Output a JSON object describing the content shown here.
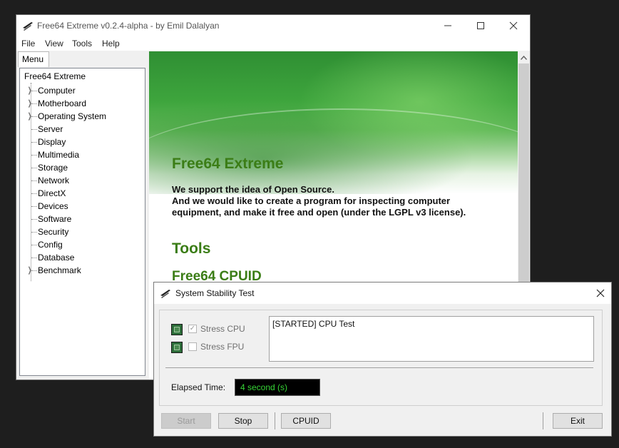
{
  "main_window": {
    "title": "Free64 Extreme v0.2.4-alpha - by Emil Dalalyan",
    "menu": [
      "File",
      "View",
      "Tools",
      "Help"
    ],
    "tab_label": "Menu",
    "tree": {
      "root": "Free64 Extreme",
      "items": [
        {
          "label": "Computer",
          "expandable": true
        },
        {
          "label": "Motherboard",
          "expandable": true
        },
        {
          "label": "Operating System",
          "expandable": true
        },
        {
          "label": "Server",
          "expandable": false
        },
        {
          "label": "Display",
          "expandable": false
        },
        {
          "label": "Multimedia",
          "expandable": false
        },
        {
          "label": "Storage",
          "expandable": false
        },
        {
          "label": "Network",
          "expandable": false
        },
        {
          "label": "DirectX",
          "expandable": false
        },
        {
          "label": "Devices",
          "expandable": false
        },
        {
          "label": "Software",
          "expandable": false
        },
        {
          "label": "Security",
          "expandable": false
        },
        {
          "label": "Config",
          "expandable": false
        },
        {
          "label": "Database",
          "expandable": false
        },
        {
          "label": "Benchmark",
          "expandable": true
        }
      ]
    },
    "content": {
      "heading": "Free64 Extreme",
      "paragraph_lines": [
        "We support the idea of Open Source.",
        "And we would like to create a program for inspecting computer",
        "equipment, and make it free and open (under the LGPL v3 license)."
      ],
      "section_heading": "Tools",
      "subsection_heading": "Free64 CPUID"
    }
  },
  "dialog": {
    "title": "System Stability Test",
    "stress_cpu": {
      "label": "Stress CPU",
      "checked": true
    },
    "stress_fpu": {
      "label": "Stress FPU",
      "checked": false
    },
    "log_text": "[STARTED] CPU Test",
    "elapsed_label": "Elapsed Time:",
    "elapsed_value": "4 second (s)",
    "buttons": {
      "start": "Start",
      "stop": "Stop",
      "cpuid": "CPUID",
      "exit": "Exit"
    }
  },
  "icons": {
    "app": "lightning-bolt-icon",
    "minimize": "minimize-icon",
    "maximize": "maximize-icon",
    "close": "close-icon",
    "tree_expand": "chevron-right-icon",
    "chip": "cpu-chip-icon"
  }
}
